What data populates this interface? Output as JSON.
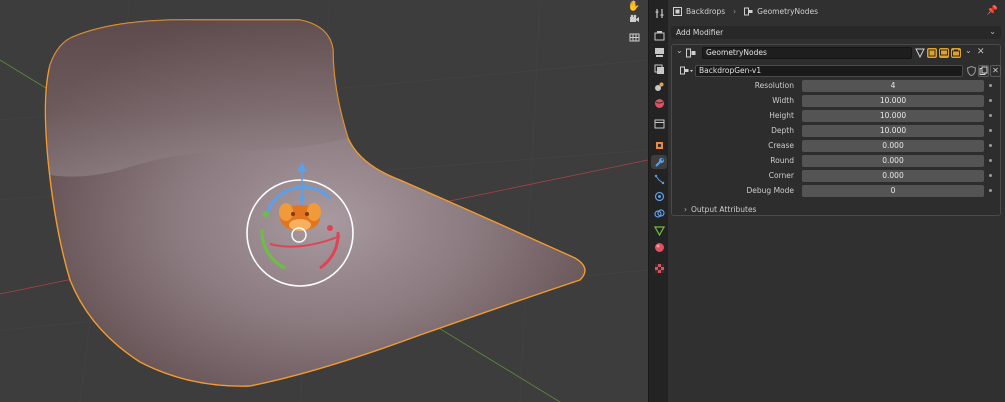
{
  "viewport": {
    "tools": [
      {
        "name": "hand-icon",
        "glyph": "✋"
      },
      {
        "name": "camera-icon",
        "glyph": "🎥"
      },
      {
        "name": "grid-icon",
        "glyph": "▦"
      }
    ],
    "colors": {
      "background": "#3d3d3d",
      "selection_outline": "#f39b2d",
      "x_axis": "#a8404a",
      "y_axis": "#6a9b3a",
      "gizmo_ring": "#ffffff"
    }
  },
  "property_tabs": [
    {
      "name": "tool-icon",
      "color": "#c8c8c8"
    },
    {
      "name": "render-icon",
      "color": "#c8c8c8"
    },
    {
      "name": "output-icon",
      "color": "#c8c8c8"
    },
    {
      "name": "view-layer-icon",
      "color": "#c8c8c8"
    },
    {
      "name": "scene-icon",
      "color": "#c8c8c8"
    },
    {
      "name": "world-icon",
      "color": "#e05060"
    },
    {
      "name": "collection-icon",
      "color": "#c8c8c8"
    },
    {
      "name": "object-icon",
      "color": "#f0883a"
    },
    {
      "name": "modifier-wrench-icon",
      "color": "#5aa0e8",
      "active": true
    },
    {
      "name": "particles-icon",
      "color": "#5aa0e8"
    },
    {
      "name": "physics-icon",
      "color": "#5aa0e8"
    },
    {
      "name": "constraints-icon",
      "color": "#5aa0e8"
    },
    {
      "name": "data-icon",
      "color": "#6cc040"
    },
    {
      "name": "material-icon",
      "color": "#e05060"
    },
    {
      "name": "texture-icon",
      "color": "#e05060"
    }
  ],
  "breadcrumb": {
    "object": "Backdrops",
    "separator": "›",
    "modifier": "GeometryNodes"
  },
  "add_modifier": {
    "label": "Add Modifier"
  },
  "modifier": {
    "name": "GeometryNodes",
    "node_group": "BackdropGen-v1",
    "params": [
      {
        "label": "Resolution",
        "value": "4"
      },
      {
        "label": "Width",
        "value": "10.000"
      },
      {
        "label": "Height",
        "value": "10.000"
      },
      {
        "label": "Depth",
        "value": "10.000"
      },
      {
        "label": "Crease",
        "value": "0.000"
      },
      {
        "label": "Round",
        "value": "0.000"
      },
      {
        "label": "Corner",
        "value": "0.000"
      },
      {
        "label": "Debug Mode",
        "value": "0"
      }
    ],
    "output_attributes_label": "Output Attributes"
  }
}
